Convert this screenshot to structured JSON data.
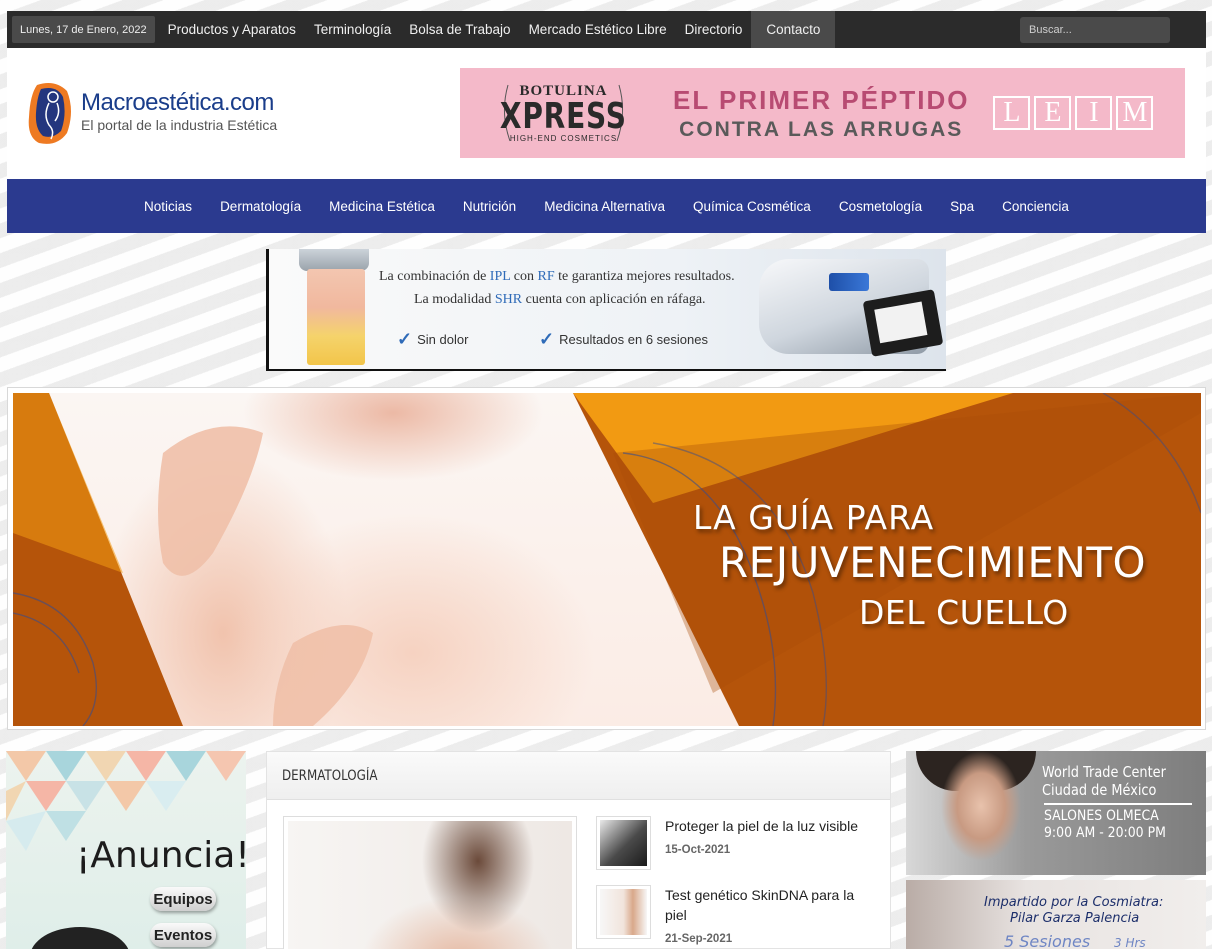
{
  "topbar": {
    "date": "Lunes, 17 de Enero, 2022",
    "links": [
      "Productos y Aparatos",
      "Terminología",
      "Bolsa de Trabajo",
      "Mercado Estético Libre",
      "Directorio",
      "Contacto"
    ],
    "search_placeholder": "Buscar..."
  },
  "header": {
    "logo_title": "Macroestética.com",
    "logo_tagline": "El portal de la industria Estética",
    "ad": {
      "brand_line1": "BOTULINA",
      "brand_line2": "XPRESS",
      "brand_line3": "HIGH-END COSMETICS",
      "headline1": "EL PRIMER PÉPTIDO",
      "headline2": "CONTRA LAS ARRUGAS",
      "leim": [
        "L",
        "E",
        "I",
        "M"
      ]
    }
  },
  "mainnav": {
    "items": [
      "Noticias",
      "Dermatología",
      "Medicina Estética",
      "Nutrición",
      "Medicina Alternativa",
      "Química Cosmética",
      "Cosmetología",
      "Spa",
      "Conciencia"
    ]
  },
  "ipl_ad": {
    "line1_pre": "La combinación de ",
    "line1_a": "IPL",
    "line1_mid": " con ",
    "line1_b": "RF",
    "line1_post": " te garantiza mejores resultados.",
    "line2_pre": "La modalidad ",
    "line2_a": "SHR",
    "line2_post": " cuenta con aplicación en ráfaga.",
    "check1": "Sin dolor",
    "check2": "Resultados en 6 sesiones"
  },
  "hero": {
    "line1": "LA GUÍA PARA",
    "line2": "REJUVENECIMIENTO",
    "line3": "DEL CUELLO"
  },
  "left_ad": {
    "title": "¡Anuncia!",
    "buttons": [
      "Equipos",
      "Eventos"
    ]
  },
  "section": {
    "title": "DERMATOLOGÍA",
    "articles": [
      {
        "title": "Proteger la piel de la luz visible",
        "date": "15-Oct-2021"
      },
      {
        "title": "Test genético SkinDNA para la piel",
        "date": "21-Sep-2021"
      }
    ]
  },
  "right_ad1": {
    "line1": "World Trade Center",
    "line2": "Ciudad de México",
    "line3": "SALONES OLMECA",
    "line4": "9:00 AM - 20:00 PM"
  },
  "right_ad2": {
    "line1": "Impartido por la Cosmiatra:",
    "line2": "Pilar Garza Palencia",
    "line3": "5 Sesiones",
    "line4": "3 Hrs"
  },
  "colors": {
    "topbar": "#2b2b2b",
    "mainnav": "#2b3a8f",
    "hero_orange": "#b5540a",
    "hero_accent": "#f29a12"
  }
}
